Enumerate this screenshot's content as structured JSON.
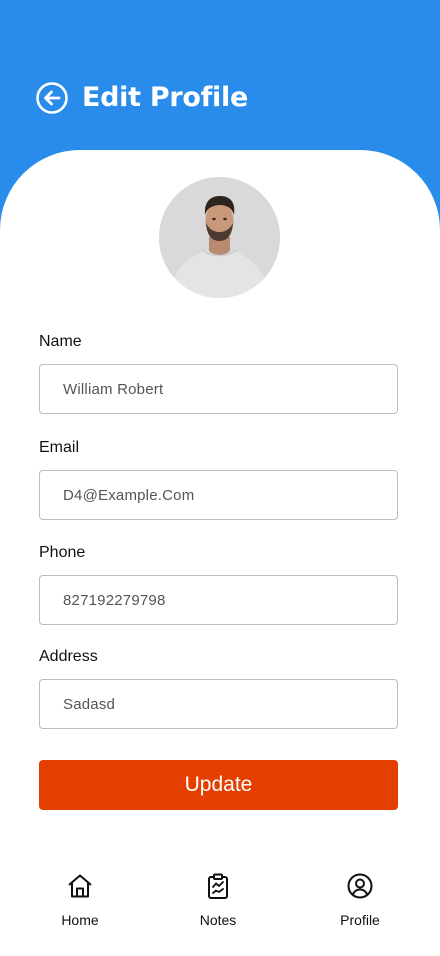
{
  "header": {
    "title": "Edit Profile",
    "back_icon": "arrow-left-circle-icon",
    "background_color": "#2a8cea"
  },
  "profile": {
    "avatar_icon": "user-photo"
  },
  "form": {
    "name_label": "Name",
    "name_value": "William Robert",
    "email_label": "Email",
    "email_value": "D4@Example.Com",
    "phone_label": "Phone",
    "phone_value": "827192279798",
    "address_label": "Address",
    "address_value": "Sadasd"
  },
  "actions": {
    "update_label": "Update",
    "update_color": "#e43f00"
  },
  "nav": {
    "items": [
      {
        "label": "Home",
        "icon": "home-icon"
      },
      {
        "label": "Notes",
        "icon": "clipboard-chart-icon"
      },
      {
        "label": "Profile",
        "icon": "user-circle-icon"
      }
    ]
  }
}
